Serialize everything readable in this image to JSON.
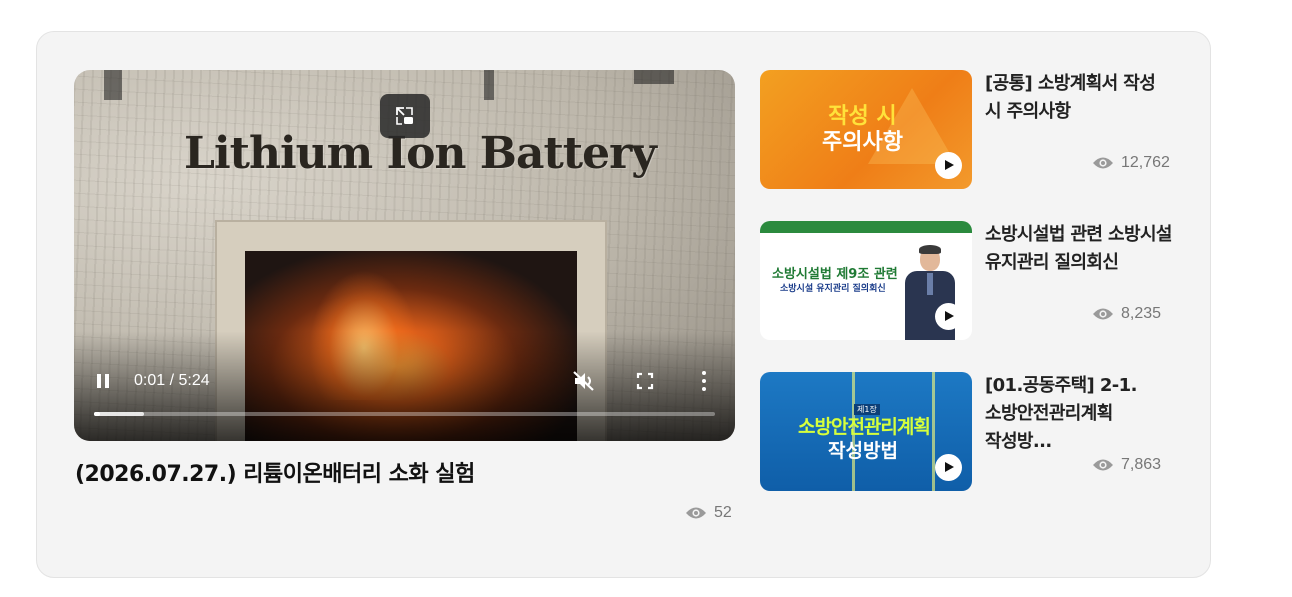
{
  "main_video": {
    "frame_title": "Lithium Ion Battery",
    "time_current": "0:01",
    "time_separator": "/",
    "time_total": "5:24",
    "progress_fraction": 0.003,
    "title": "(2026.07.27.) 리튬이온배터리 소화 실험",
    "views": "52"
  },
  "side_videos": [
    {
      "title": "[공통] 소방계획서 작성 시 주의사항",
      "views": "12,762",
      "thumb_line1": "작성 시",
      "thumb_line2": "주의사항"
    },
    {
      "title": "소방시설법 관련 소방시설 유지관리 질의회신",
      "views": "8,235",
      "thumb_line1": "소방시설법 제9조 관련",
      "thumb_line2": "소방시설 유지관리 질의회신"
    },
    {
      "title": "[01.공동주택] 2-1.소방안전관리계획 작성방...",
      "views": "7,863",
      "thumb_tag": "제1장",
      "thumb_line1": "소방안전관리계획",
      "thumb_line2": "작성방법"
    }
  ],
  "colors": {
    "panel_bg": "#f4f4f4",
    "views_text": "#777777",
    "title_text": "#111111"
  },
  "icons": [
    "pip-icon",
    "pause-icon",
    "mute-icon",
    "fullscreen-icon",
    "more-vert-icon",
    "eye-icon",
    "play-icon"
  ]
}
